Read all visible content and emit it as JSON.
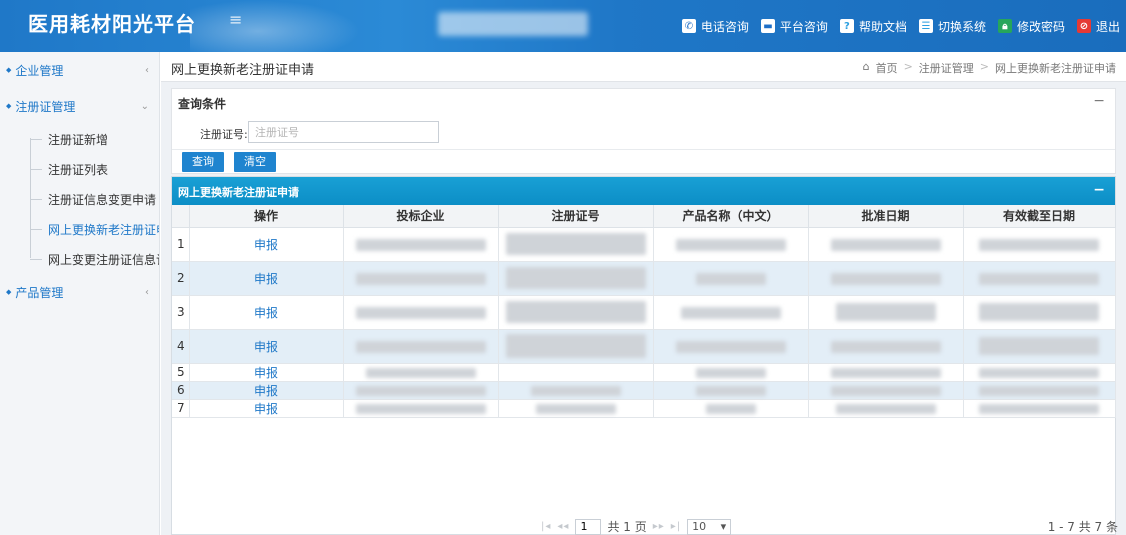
{
  "app": {
    "title": "医用耗材阳光平台"
  },
  "topnav": [
    {
      "label": "电话咨询",
      "icon": "phone-icon",
      "color": "#1e6fc7"
    },
    {
      "label": "平台咨询",
      "icon": "chat-icon",
      "color": "#1e6fc7"
    },
    {
      "label": "帮助文档",
      "icon": "help-icon",
      "color": "#2ea0e0"
    },
    {
      "label": "切换系统",
      "icon": "switch-icon",
      "color": "#2ea0e0"
    },
    {
      "label": "修改密码",
      "icon": "lock-icon",
      "color": "#26a65b"
    },
    {
      "label": "退出",
      "icon": "logout-icon",
      "color": "#e53935"
    }
  ],
  "sidebar": {
    "groups": [
      {
        "label": "企业管理",
        "arrow": "‹"
      },
      {
        "label": "注册证管理",
        "arrow": "⌄"
      },
      {
        "label": "产品管理",
        "arrow": "‹"
      }
    ],
    "subitems": [
      {
        "label": "注册证新增"
      },
      {
        "label": "注册证列表"
      },
      {
        "label": "注册证信息变更申请"
      },
      {
        "label": "网上更换新老注册证申请"
      },
      {
        "label": "网上变更注册证信息记录"
      }
    ]
  },
  "page": {
    "title": "网上更换新老注册证申请",
    "breadcrumb": [
      "首页",
      "注册证管理",
      "网上更换新老注册证申请"
    ]
  },
  "query": {
    "title": "查询条件",
    "field_label": "注册证号:",
    "field_placeholder": "注册证号",
    "search_label": "查询",
    "clear_label": "清空"
  },
  "grid": {
    "title": "网上更换新老注册证申请",
    "columns": [
      "",
      "操作",
      "投标企业",
      "注册证号",
      "产品名称（中文）",
      "批准日期",
      "有效截至日期"
    ],
    "rows": [
      {
        "num": "1",
        "action": "申报"
      },
      {
        "num": "2",
        "action": "申报"
      },
      {
        "num": "3",
        "action": "申报"
      },
      {
        "num": "4",
        "action": "申报"
      },
      {
        "num": "5",
        "action": "申报"
      },
      {
        "num": "6",
        "action": "申报"
      },
      {
        "num": "7",
        "action": "申报"
      }
    ]
  },
  "pager": {
    "page_value": "1",
    "total_pages": "共 1 页",
    "page_size": "10",
    "summary": "1 - 7   共 7 条"
  }
}
